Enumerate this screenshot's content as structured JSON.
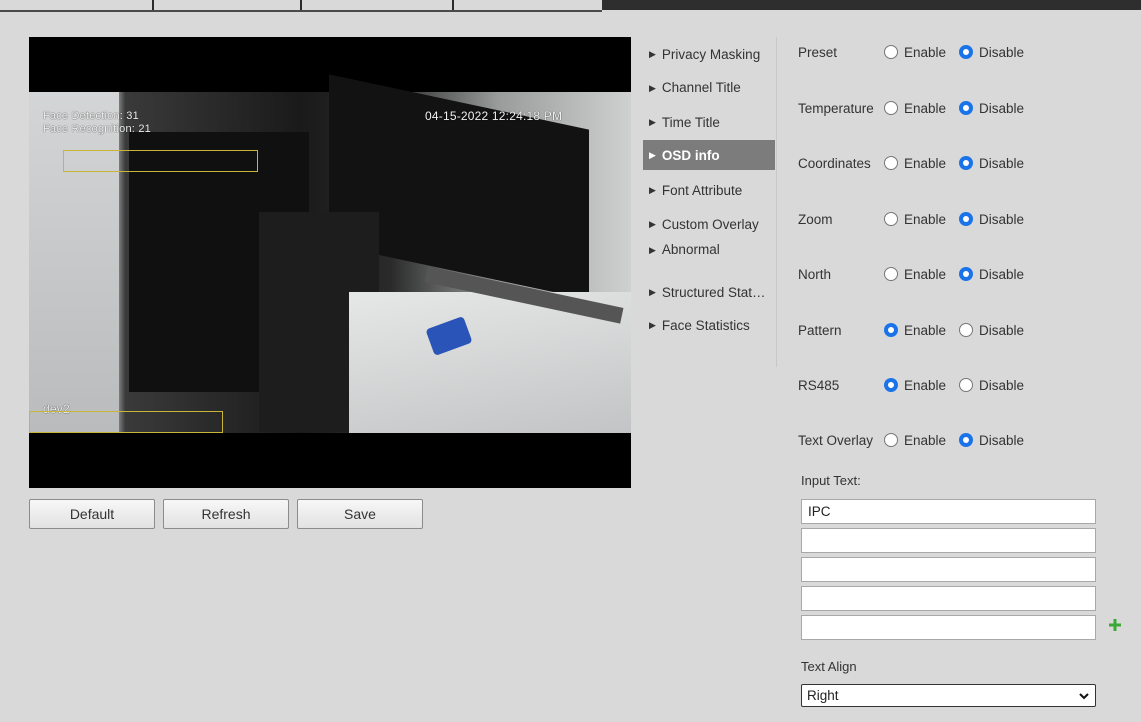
{
  "video": {
    "osd_line1": "Face Detection: 31",
    "osd_line2": "Face Recognition: 21",
    "timestamp": "04-15-2022 12:24:18 PM",
    "channel_title": "dev2"
  },
  "buttons": {
    "default": "Default",
    "refresh": "Refresh",
    "save": "Save"
  },
  "menu": {
    "items": [
      {
        "label": "Privacy Masking"
      },
      {
        "label": "Channel Title"
      },
      {
        "label": "Time Title"
      },
      {
        "label": "OSD info"
      },
      {
        "label": "Font Attribute"
      },
      {
        "label": "Custom Overlay"
      },
      {
        "label": "Abnormal"
      },
      {
        "label": "Structured Statistics"
      },
      {
        "label": "Face Statistics"
      }
    ],
    "active_index": 3
  },
  "settings": {
    "enable_label": "Enable",
    "disable_label": "Disable",
    "rows": [
      {
        "label": "Preset",
        "value": "Disable"
      },
      {
        "label": "Temperature",
        "value": "Disable"
      },
      {
        "label": "Coordinates",
        "value": "Disable"
      },
      {
        "label": "Zoom",
        "value": "Disable"
      },
      {
        "label": "North",
        "value": "Disable"
      },
      {
        "label": "Pattern",
        "value": "Enable"
      },
      {
        "label": "RS485",
        "value": "Enable"
      },
      {
        "label": "Text Overlay",
        "value": "Disable"
      }
    ]
  },
  "text_overlay": {
    "input_label": "Input Text:",
    "lines": [
      "IPC",
      "",
      "",
      "",
      ""
    ],
    "add_icon": "plus-icon",
    "align_label": "Text Align",
    "align_value": "Right"
  },
  "colors": {
    "accent": "#1a73e8",
    "menu_active_bg": "#7c7c7c",
    "add_icon": "#3aa935"
  }
}
